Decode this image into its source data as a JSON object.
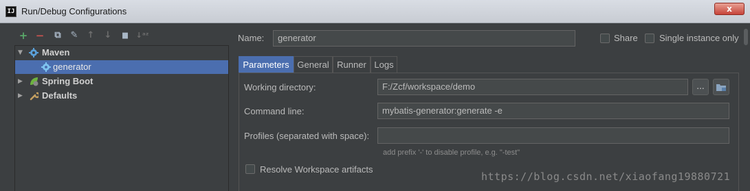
{
  "window": {
    "title": "Run/Debug Configurations",
    "app_icon_text": "IJ",
    "close_label": "x"
  },
  "toolbar": {
    "add": "+",
    "remove": "−",
    "copy": "⧉",
    "edit_defaults": "✎",
    "move_up": "↑",
    "move_down": "↓",
    "folder": "▆",
    "sort": "↓ᵃᶻ"
  },
  "tree": {
    "items": [
      {
        "label": "Maven",
        "expanded": true
      },
      {
        "label": "generator",
        "selected": true
      },
      {
        "label": "Spring Boot",
        "expanded": false
      },
      {
        "label": "Defaults",
        "expanded": false
      }
    ]
  },
  "form": {
    "name_label": "Name:",
    "name_value": "generator",
    "share_label": "Share",
    "single_instance_label": "Single instance only"
  },
  "tabs": [
    "Parameters",
    "General",
    "Runner",
    "Logs"
  ],
  "parameters": {
    "working_dir_label": "Working directory:",
    "working_dir_value": "F:/Zcf/workspace/demo",
    "browse_label": "...",
    "command_line_label": "Command line:",
    "command_line_value": "mybatis-generator:generate -e",
    "profiles_label": "Profiles (separated with space):",
    "profiles_value": "",
    "profiles_hint": "add prefix '-' to disable profile, e.g. \"-test\"",
    "resolve_label": "Resolve Workspace artifacts"
  },
  "watermark": "https://blog.csdn.net/xiaofang19880721",
  "colors": {
    "selection": "#4b6eaf",
    "background": "#3c3f41",
    "add_icon": "#59a869",
    "remove_icon": "#c75450"
  }
}
